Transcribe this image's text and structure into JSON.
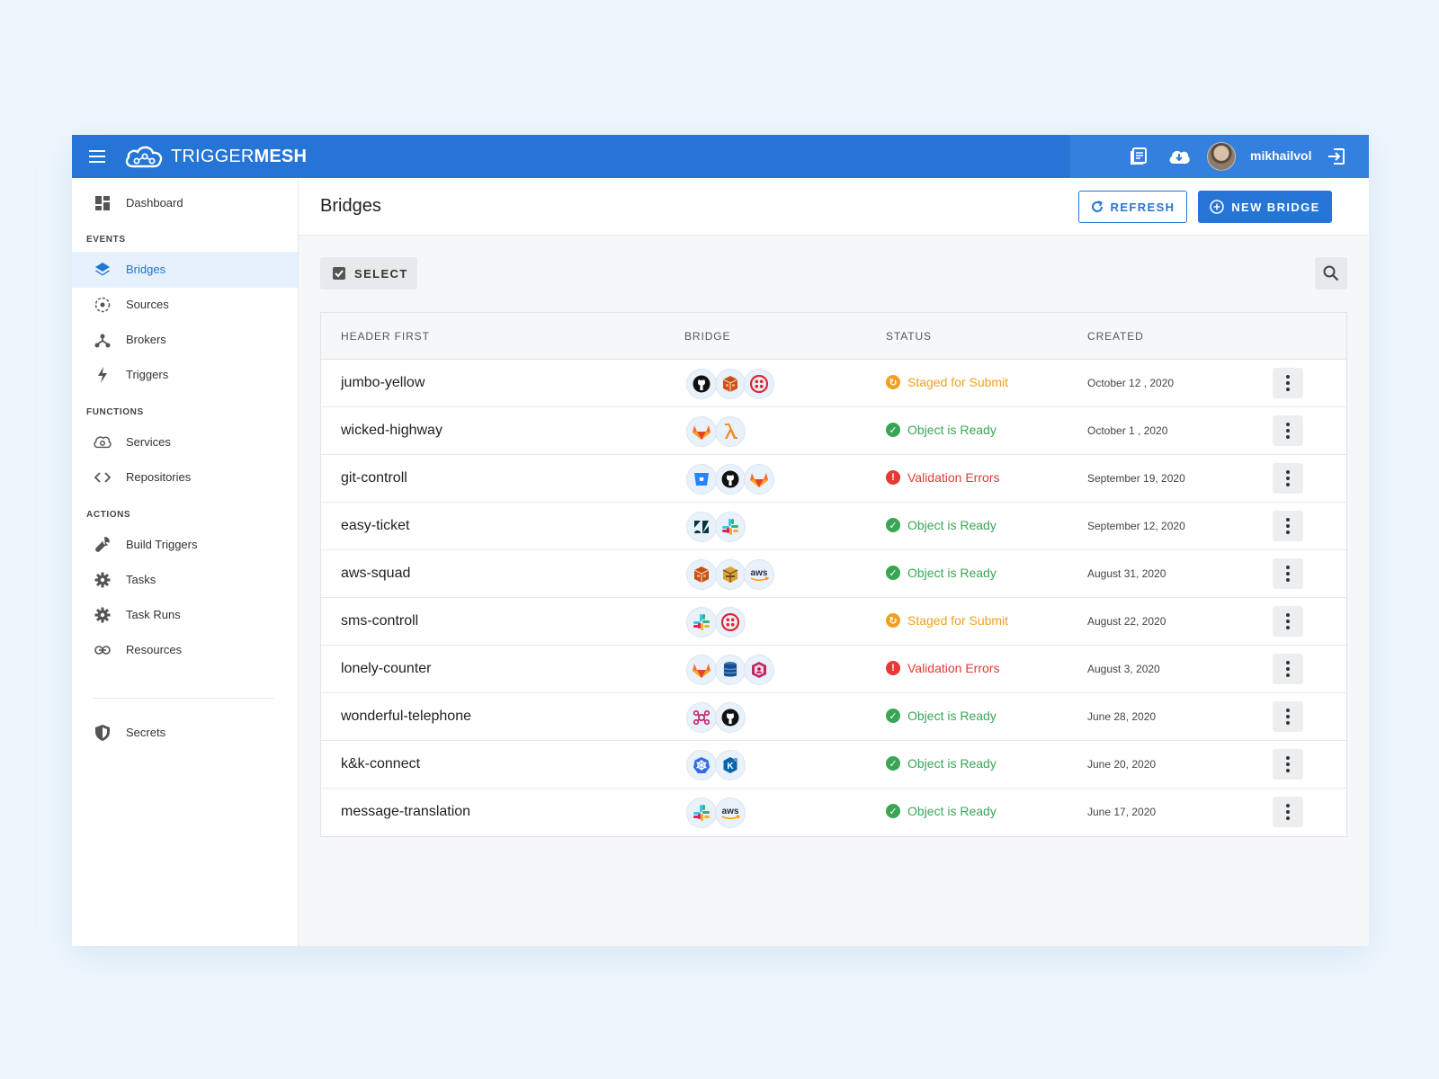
{
  "app": {
    "logo_light": "TRIGGER",
    "logo_bold": "MESH",
    "username": "mikhailvol"
  },
  "sidebar": {
    "dashboard": "Dashboard",
    "sections": {
      "events": "EVENTS",
      "functions": "FUNCTIONS",
      "actions": "ACTIONS"
    },
    "items": {
      "bridges": "Bridges",
      "sources": "Sources",
      "brokers": "Brokers",
      "triggers": "Triggers",
      "services": "Services",
      "repositories": "Repositories",
      "build_triggers": "Build Triggers",
      "tasks": "Tasks",
      "task_runs": "Task Runs",
      "resources": "Resources",
      "secrets": "Secrets"
    },
    "active": "bridges"
  },
  "main": {
    "title": "Bridges",
    "refresh_label": "REFRESH",
    "new_bridge_label": "NEW BRIDGE",
    "select_label": "SELECT"
  },
  "table": {
    "headers": {
      "name": "HEADER FIRST",
      "bridge": "BRIDGE",
      "status": "STATUS",
      "created": "CREATED"
    },
    "rows": [
      {
        "name": "jumbo-yellow",
        "icons": [
          "github",
          "aws-box",
          "twilio"
        ],
        "status": "Staged for Submit",
        "status_type": "staged",
        "created": "October 12 , 2020"
      },
      {
        "name": "wicked-highway",
        "icons": [
          "gitlab",
          "lambda"
        ],
        "status": "Object is Ready",
        "status_type": "ready",
        "created": "October 1 , 2020"
      },
      {
        "name": "git-controll",
        "icons": [
          "bitbucket",
          "github",
          "gitlab"
        ],
        "status": "Validation Errors",
        "status_type": "error",
        "created": "September 19, 2020"
      },
      {
        "name": "easy-ticket",
        "icons": [
          "zendesk",
          "slack"
        ],
        "status": "Object is Ready",
        "status_type": "ready",
        "created": "September 12, 2020"
      },
      {
        "name": "aws-squad",
        "icons": [
          "aws-box",
          "aws-box-gold",
          "aws"
        ],
        "status": "Object is Ready",
        "status_type": "ready",
        "created": "August 31, 2020"
      },
      {
        "name": "sms-controll",
        "icons": [
          "slack",
          "twilio"
        ],
        "status": "Staged for Submit",
        "status_type": "staged",
        "created": "August 22, 2020"
      },
      {
        "name": "lonely-counter",
        "icons": [
          "gitlab",
          "dynamodb",
          "cognito"
        ],
        "status": "Validation Errors",
        "status_type": "error",
        "created": "August 3, 2020"
      },
      {
        "name": "wonderful-telephone",
        "icons": [
          "eventbridge",
          "github"
        ],
        "status": "Object is Ready",
        "status_type": "ready",
        "created": "June 28, 2020"
      },
      {
        "name": "k&k-connect",
        "icons": [
          "kubernetes",
          "knative"
        ],
        "status": "Object is Ready",
        "status_type": "ready",
        "created": "June 20, 2020"
      },
      {
        "name": "message-translation",
        "icons": [
          "slack",
          "aws"
        ],
        "status": "Object is Ready",
        "status_type": "ready",
        "created": "June 17, 2020"
      }
    ]
  },
  "colors": {
    "brand": "#2475d6",
    "ready": "#3aa655",
    "staged": "#f0a020",
    "error": "#e53935"
  }
}
